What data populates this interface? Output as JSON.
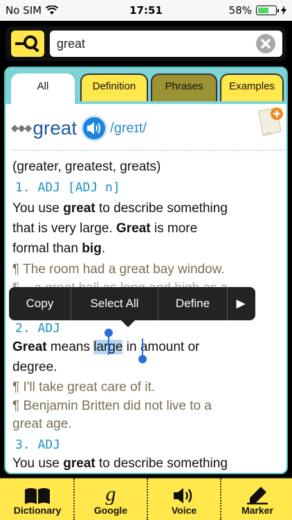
{
  "status": {
    "carrier": "No SIM",
    "time": "17:51",
    "battery": "58%"
  },
  "search": {
    "value": "great"
  },
  "tabs": [
    "All",
    "Definition",
    "Phrases",
    "Examples"
  ],
  "entry": {
    "diamonds": "◆◆◆",
    "headword": "great",
    "pronunciation": "/greɪt/",
    "forms": "(greater, greatest, greats)",
    "sense1_label": "1. ADJ [ADJ n]",
    "sense1_def_a": "You use ",
    "sense1_def_b": "great",
    "sense1_def_c": " to describe something",
    "sense1_def2_a": "that is very large. ",
    "sense1_def2_b": "Great",
    "sense1_def2_c": " is more",
    "sense1_def3_a": "formal than ",
    "sense1_def3_b": "big",
    "sense1_def3_c": ".",
    "ex1": "¶ The room had a great bay window.",
    "ex2": "¶ ...a great hall as long and high as a",
    "sense2_label": "2. ADJ",
    "sense2_def_a": "Great",
    "sense2_def_b": " means ",
    "sense2_def_sel": "large",
    "sense2_def_c": " in amount or",
    "sense2_def2": "degree.",
    "ex3": "¶ I'll take great care of it.",
    "ex4": "¶ Benjamin Britten did not live to a",
    "ex4b": "great age.",
    "sense3_label": "3. ADJ",
    "sense3_def_a": "You use ",
    "sense3_def_b": "great",
    "sense3_def_c": " to describe something"
  },
  "context_menu": {
    "copy": "Copy",
    "select_all": "Select All",
    "define": "Define",
    "more": "▶"
  },
  "bottom_bar": {
    "dictionary": "Dictionary",
    "google": "Google",
    "voice": "Voice",
    "marker": "Marker"
  },
  "colors": {
    "accent_yellow": "#ffe74c",
    "tab_teal": "#7ed3d6",
    "headword_blue": "#1a5aa5",
    "sense_blue": "#1e8fc9",
    "example_brown": "#7a6f54"
  }
}
